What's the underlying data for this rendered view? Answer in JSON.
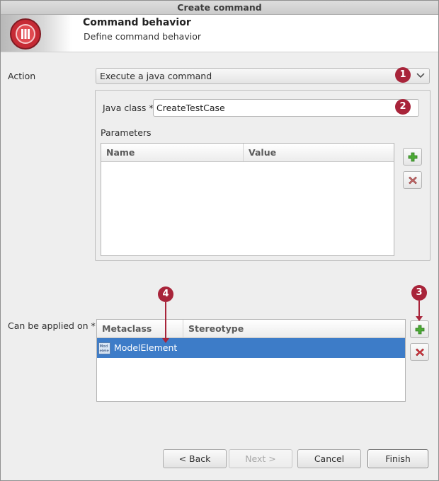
{
  "window": {
    "title": "Create command"
  },
  "banner": {
    "title": "Command behavior",
    "subtitle": "Define command behavior"
  },
  "action": {
    "label": "Action",
    "selected": "Execute a java command"
  },
  "java_class": {
    "label": "Java class *",
    "value": "CreateTestCase"
  },
  "parameters": {
    "label": "Parameters",
    "columns": [
      "Name",
      "Value"
    ],
    "rows": []
  },
  "applied_on": {
    "label": "Can be applied on *",
    "columns": [
      "Metaclass",
      "Stereotype"
    ],
    "rows": [
      {
        "metaclass": "ModelElement",
        "stereotype": "",
        "icon_text": "Mod elele"
      }
    ]
  },
  "footer": {
    "back": "< Back",
    "next": "Next >",
    "cancel": "Cancel",
    "finish": "Finish"
  },
  "markers": [
    "1",
    "2",
    "3",
    "4"
  ],
  "icons": {
    "logo": "modelio-logo-icon",
    "chevron": "chevron-down-icon",
    "add": "add-icon",
    "remove": "remove-icon",
    "row": "metaclass-icon"
  },
  "colors": {
    "marker": "#a8243a",
    "selection": "#3d7cc8",
    "add": "#3f9c2e",
    "remove": "#c0303a"
  }
}
